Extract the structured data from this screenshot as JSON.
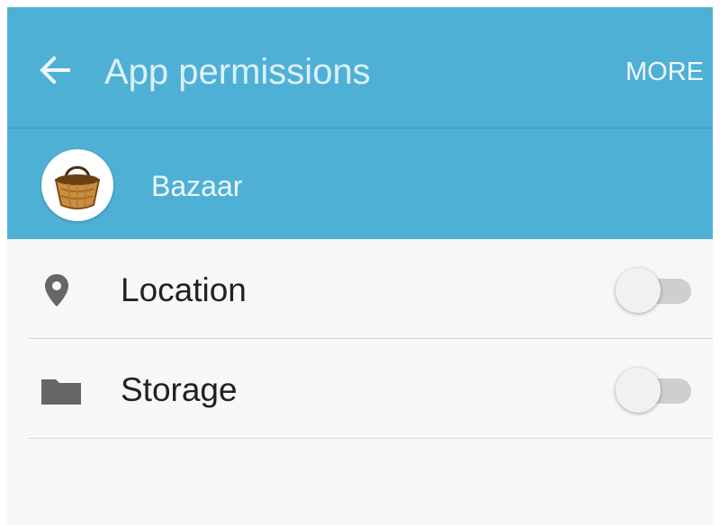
{
  "toolbar": {
    "title": "App permissions",
    "more_label": "MORE",
    "back_icon": "arrow-left-icon",
    "background": "#4fb0d6"
  },
  "app": {
    "name": "Bazaar",
    "icon": "basket-icon"
  },
  "permissions": [
    {
      "label": "Location",
      "icon": "location-pin-icon",
      "enabled": false
    },
    {
      "label": "Storage",
      "icon": "folder-icon",
      "enabled": false
    }
  ]
}
